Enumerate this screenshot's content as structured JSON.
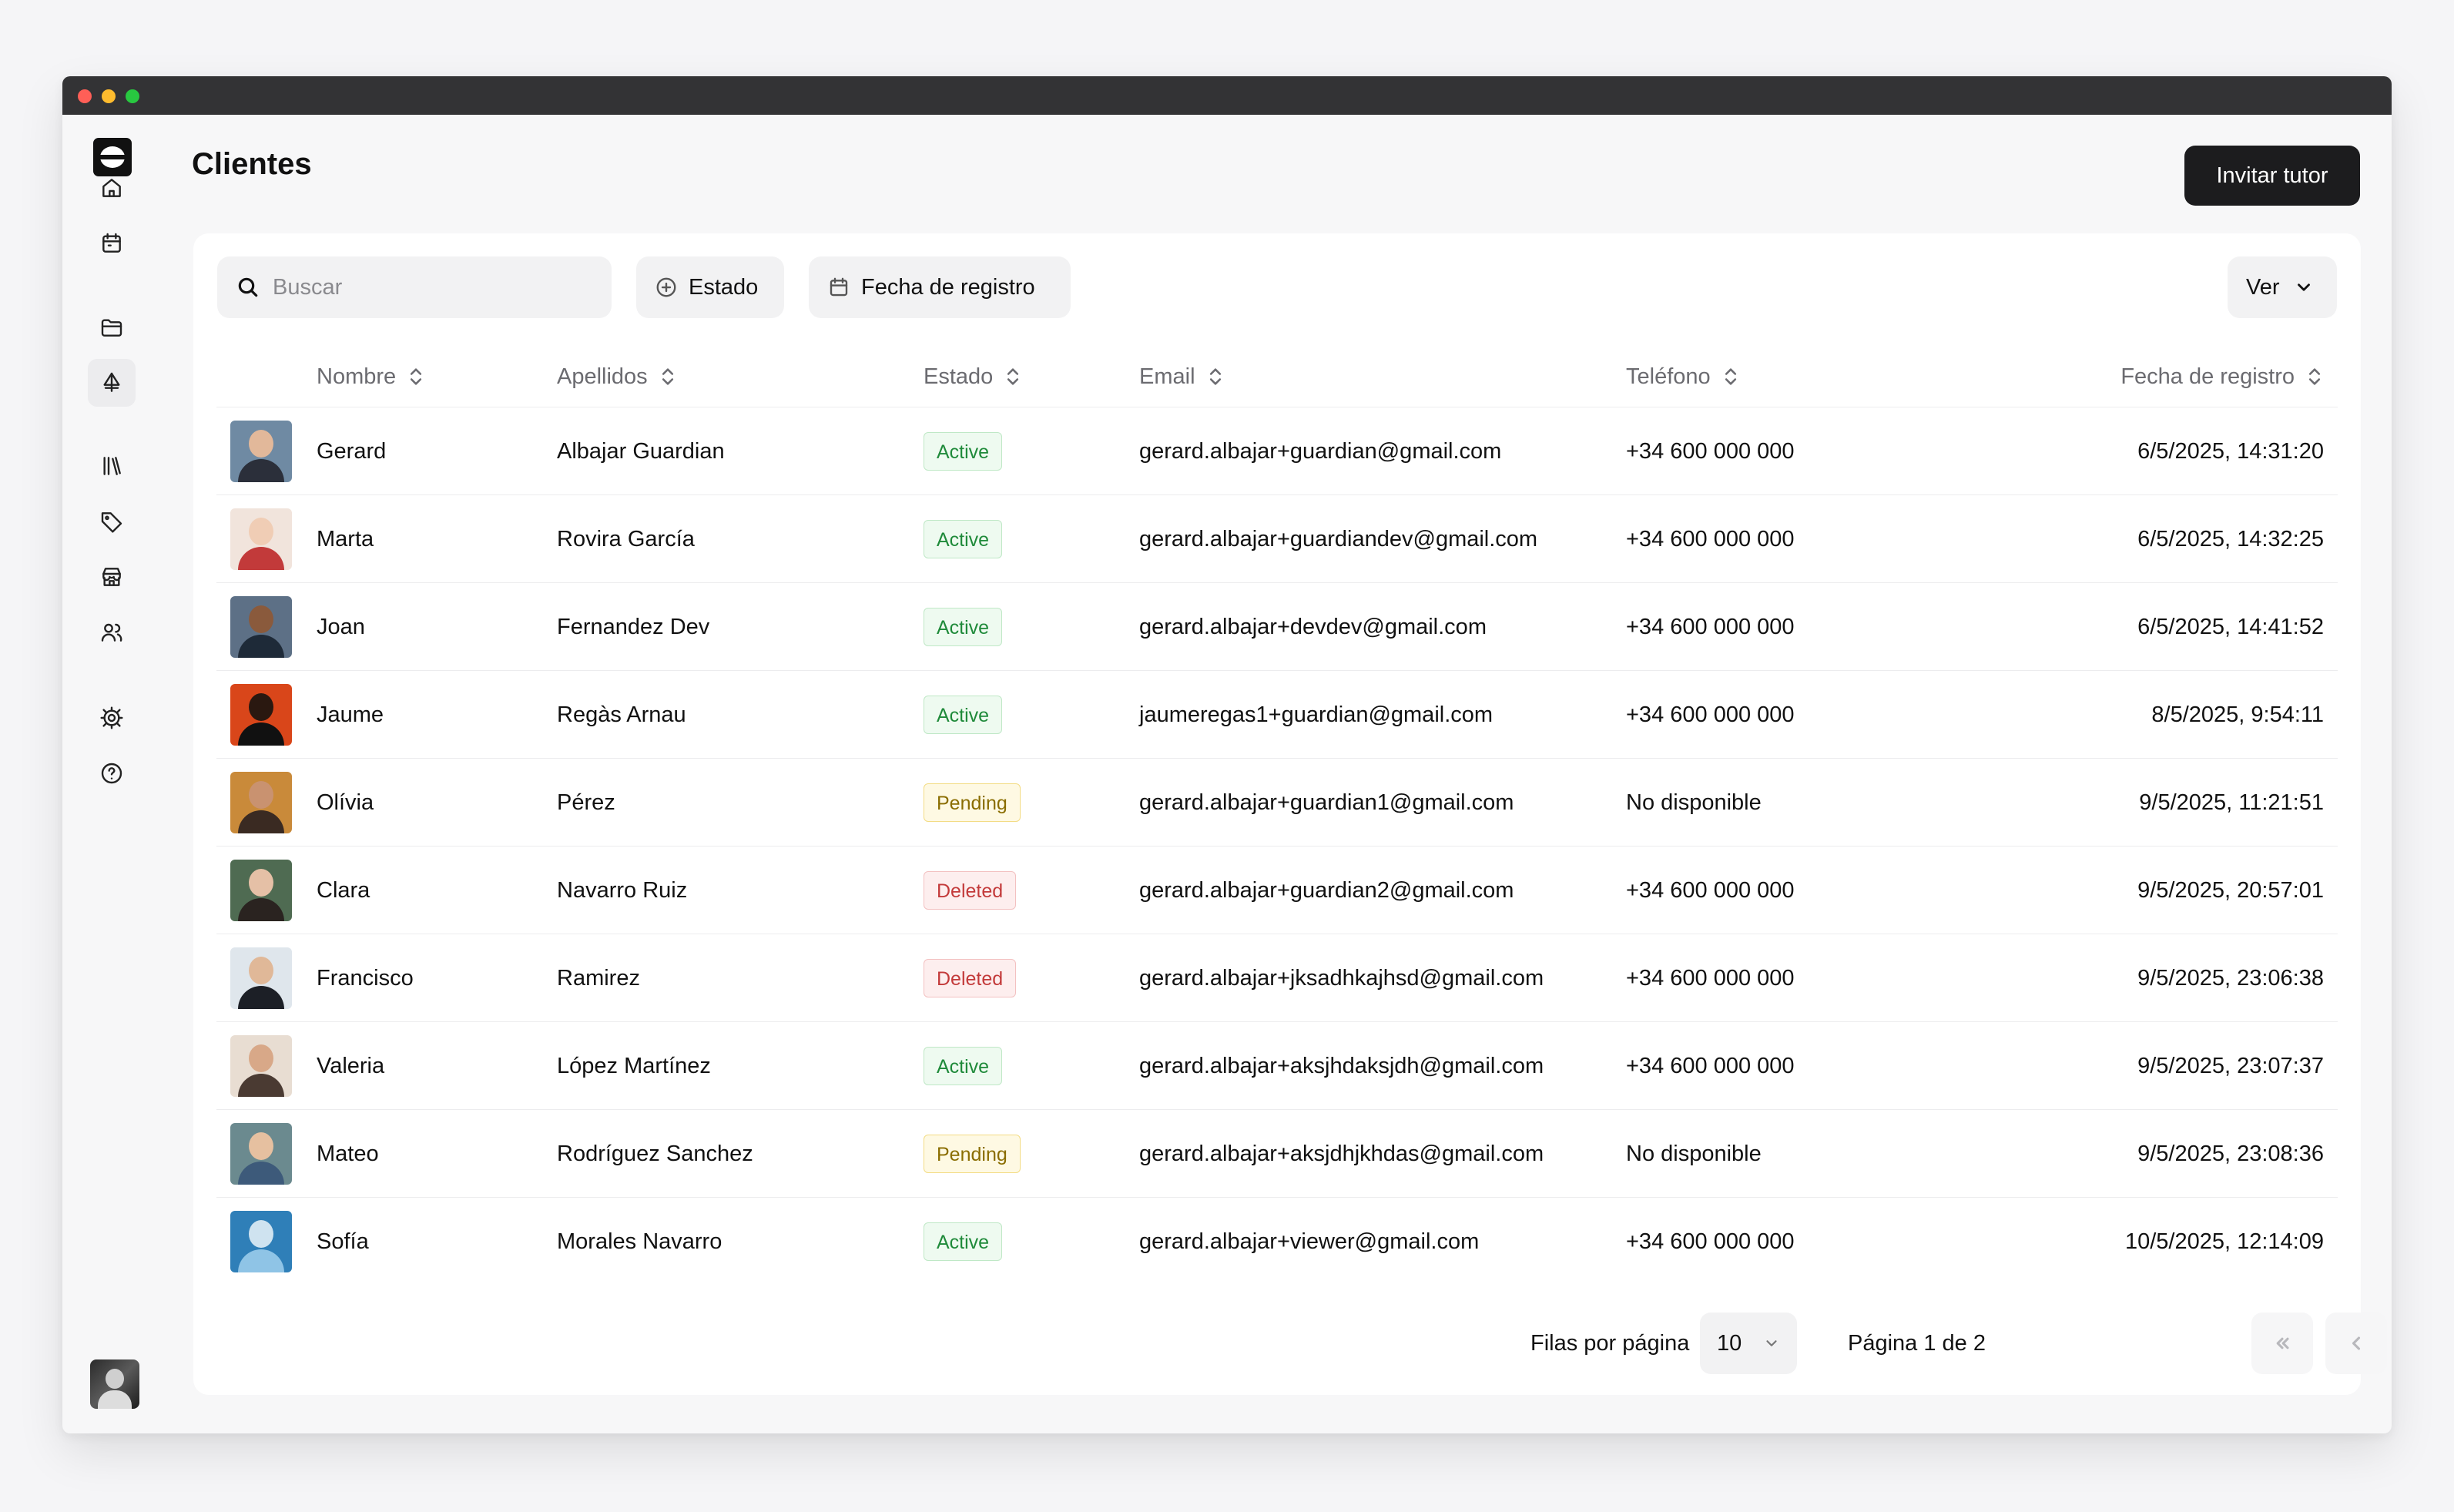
{
  "page": {
    "title": "Clientes",
    "invite_label": "Invitar tutor"
  },
  "sidebar": {
    "items": [
      {
        "icon": "home-icon"
      },
      {
        "icon": "calendar-icon"
      },
      {
        "icon": "folder-icon"
      },
      {
        "icon": "sailboat-icon",
        "active": true
      },
      {
        "icon": "library-icon"
      },
      {
        "icon": "tag-icon"
      },
      {
        "icon": "store-icon"
      },
      {
        "icon": "users-icon"
      },
      {
        "icon": "settings-icon"
      },
      {
        "icon": "help-icon"
      }
    ]
  },
  "toolbar": {
    "search_placeholder": "Buscar",
    "filter_status": "Estado",
    "filter_date": "Fecha de registro",
    "view_label": "Ver"
  },
  "table": {
    "columns": {
      "name": "Nombre",
      "last": "Apellidos",
      "status": "Estado",
      "email": "Email",
      "phone": "Teléfono",
      "date": "Fecha de registro"
    },
    "rows": [
      {
        "name": "Gerard",
        "last": "Albajar Guardian",
        "status": "Active",
        "email": "gerard.albajar+guardian@gmail.com",
        "phone": "+34 600 000 000",
        "date": "6/5/2025, 14:31:20"
      },
      {
        "name": "Marta",
        "last": "Rovira García",
        "status": "Active",
        "email": "gerard.albajar+guardiandev@gmail.com",
        "phone": "+34 600 000 000",
        "date": "6/5/2025, 14:32:25"
      },
      {
        "name": "Joan",
        "last": "Fernandez Dev",
        "status": "Active",
        "email": "gerard.albajar+devdev@gmail.com",
        "phone": "+34 600 000 000",
        "date": "6/5/2025, 14:41:52"
      },
      {
        "name": "Jaume",
        "last": "Regàs Arnau",
        "status": "Active",
        "email": "jaumeregas1+guardian@gmail.com",
        "phone": "+34 600 000 000",
        "date": "8/5/2025, 9:54:11"
      },
      {
        "name": "Olívia",
        "last": "Pérez",
        "status": "Pending",
        "email": "gerard.albajar+guardian1@gmail.com",
        "phone": "No disponible",
        "date": "9/5/2025, 11:21:51"
      },
      {
        "name": "Clara",
        "last": "Navarro Ruiz",
        "status": "Deleted",
        "email": "gerard.albajar+guardian2@gmail.com",
        "phone": "+34 600 000 000",
        "date": "9/5/2025, 20:57:01"
      },
      {
        "name": "Francisco",
        "last": "Ramirez",
        "status": "Deleted",
        "email": "gerard.albajar+jksadhkajhsd@gmail.com",
        "phone": "+34 600 000 000",
        "date": "9/5/2025, 23:06:38"
      },
      {
        "name": "Valeria",
        "last": "López Martínez",
        "status": "Active",
        "email": "gerard.albajar+aksjhdaksjdh@gmail.com",
        "phone": "+34 600 000 000",
        "date": "9/5/2025, 23:07:37"
      },
      {
        "name": "Mateo",
        "last": "Rodríguez Sanchez",
        "status": "Pending",
        "email": "gerard.albajar+aksjdhjkhdas@gmail.com",
        "phone": "No disponible",
        "date": "9/5/2025, 23:08:36"
      },
      {
        "name": "Sofía",
        "last": "Morales Navarro",
        "status": "Active",
        "email": "gerard.albajar+viewer@gmail.com",
        "phone": "+34 600 000 000",
        "date": "10/5/2025, 12:14:09"
      }
    ]
  },
  "pagination": {
    "rows_label": "Filas por página",
    "rows_value": "10",
    "page_label": "Página 1 de 2"
  },
  "colors": {
    "primary_button": "#1c1c1e",
    "active": "#1f8a3a",
    "pending": "#8a6d00",
    "deleted": "#c33a3a"
  }
}
